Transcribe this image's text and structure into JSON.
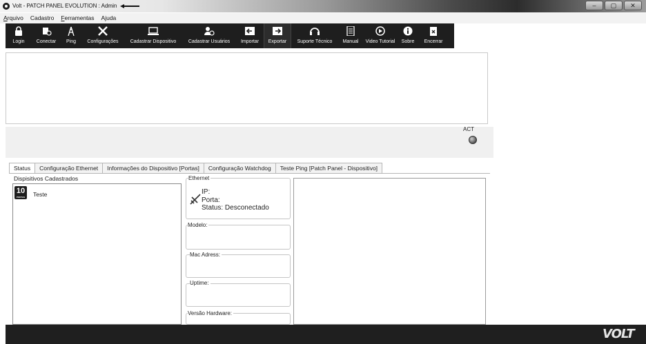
{
  "window": {
    "title": "Volt - PATCH PANEL EVOLUTION : Admin",
    "controls": [
      "–",
      "▢",
      "✕"
    ]
  },
  "menu": [
    {
      "first": "A",
      "rest": "rquivo"
    },
    {
      "first": "",
      "rest": "Cadastro"
    },
    {
      "first": "F",
      "rest": "erramentas"
    },
    {
      "first": "",
      "rest": "Ajuda"
    }
  ],
  "toolbar": [
    {
      "label": "Login",
      "icon": "lock-icon"
    },
    {
      "label": "Conectar",
      "icon": "plug-icon"
    },
    {
      "label": "Ping",
      "icon": "antenna-icon"
    },
    {
      "label": "Configurações",
      "icon": "tools-icon"
    },
    {
      "label": "Cadastrar Dispositivo",
      "icon": "device-icon"
    },
    {
      "label": "Cadastrar Usuários",
      "icon": "user-add-icon"
    },
    {
      "label": "Importar",
      "icon": "import-icon"
    },
    {
      "label": "Exportar",
      "icon": "export-icon"
    },
    {
      "label": "Suporte Técnico",
      "icon": "support-icon"
    },
    {
      "label": "Manual",
      "icon": "document-icon"
    },
    {
      "label": "Video Tutorial",
      "icon": "play-icon"
    },
    {
      "label": "Sobre",
      "icon": "info-icon"
    },
    {
      "label": "Encerrar",
      "icon": "exit-icon"
    }
  ],
  "status": {
    "act_label": "ACT"
  },
  "tabs": [
    "Status",
    "Configuração Ethernet",
    "Informações do Dispositivo [Portas]",
    "Configuração Watchdog",
    "Teste Ping [Patch Panel - Dispositivo]"
  ],
  "devices": {
    "group_label": "Dispisitivos Cadastrados",
    "icon_number": "10",
    "icon_sub": "PORTAS",
    "items": [
      "Teste"
    ]
  },
  "ethernet": {
    "group_label": "Ethernet",
    "ip_label": "IP:",
    "porta_label": "Porta:",
    "status_label": "Status: Desconectado"
  },
  "fields": {
    "modelo": "Modelo:",
    "mac": "Mac Adress:",
    "uptime": "Uptime:",
    "versao": "Versão Hardware:"
  },
  "brand": {
    "logo": "VOLT"
  },
  "colors": {
    "toolbar_bg": "#1e1e1e",
    "footer_bg": "#1f1f1f"
  }
}
